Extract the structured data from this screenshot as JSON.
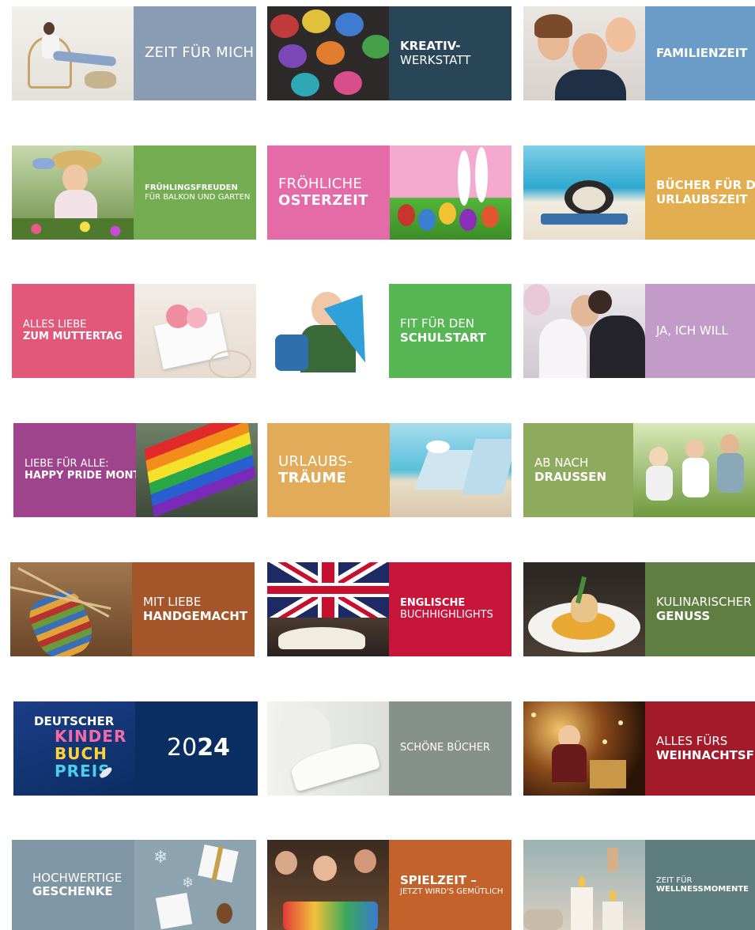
{
  "tiles": [
    {
      "id": "zeit-fuer-mich",
      "color": "#8a9cb4",
      "lines": [
        {
          "text": "ZEIT FÜR MICH",
          "bold": false,
          "size": "lg"
        }
      ]
    },
    {
      "id": "kreativ-werkstatt",
      "color": "#294558",
      "lines": [
        {
          "text": "KREATIV-",
          "bold": true,
          "size": "md"
        },
        {
          "text": "WERKSTATT",
          "bold": false,
          "size": "md"
        }
      ]
    },
    {
      "id": "familienzeit",
      "color": "#6b9cc8",
      "lines": [
        {
          "text": "FAMILIENZEIT",
          "bold": true,
          "size": "md"
        }
      ]
    },
    {
      "id": "fruehlingsfreuden",
      "color": "#74ac52",
      "lines": [
        {
          "text": "FRÜHLINGSFREUDEN",
          "bold": true,
          "size": "xs"
        },
        {
          "text": "FÜR BALKON UND GARTEN",
          "bold": false,
          "size": "xs"
        }
      ]
    },
    {
      "id": "froehliche-osterzeit",
      "color": "#e56aa8",
      "lines": [
        {
          "text": "FRÖHLICHE",
          "bold": false,
          "size": "lg"
        },
        {
          "text": "OSTERZEIT",
          "bold": true,
          "size": "lg"
        }
      ]
    },
    {
      "id": "buecher-urlaubszeit",
      "color": "#e2ae4f",
      "lines": [
        {
          "text": "BÜCHER FÜR DIE",
          "bold": true,
          "size": "md"
        },
        {
          "text": "URLAUBSZEIT",
          "bold": true,
          "size": "md"
        }
      ]
    },
    {
      "id": "muttertag",
      "color": "#e2587b",
      "lines": [
        {
          "text": "ALLES LIEBE",
          "bold": false,
          "size": "sm"
        },
        {
          "text": "ZUM MUTTERTAG",
          "bold": true,
          "size": "sm"
        }
      ]
    },
    {
      "id": "schulstart",
      "color": "#55b653",
      "lines": [
        {
          "text": "FIT FÜR DEN",
          "bold": false,
          "size": "md"
        },
        {
          "text": "SCHULSTART",
          "bold": true,
          "size": "md"
        }
      ]
    },
    {
      "id": "ja-ich-will",
      "color": "#c29bc8",
      "lines": [
        {
          "text": "JA, ICH WILL",
          "bold": false,
          "size": "md"
        }
      ]
    },
    {
      "id": "pride-month",
      "color": "#a0438d",
      "lines": [
        {
          "text": "LIEBE FÜR ALLE:",
          "bold": false,
          "size": "sm"
        },
        {
          "text": "HAPPY PRIDE MONTH",
          "bold": true,
          "size": "sm"
        }
      ]
    },
    {
      "id": "urlaubstraeume",
      "color": "#e1ab59",
      "lines": [
        {
          "text": "URLAUBS-",
          "bold": false,
          "size": "lg"
        },
        {
          "text": "TRÄUME",
          "bold": true,
          "size": "lg"
        }
      ]
    },
    {
      "id": "ab-nach-draussen",
      "color": "#8daa5d",
      "lines": [
        {
          "text": "AB NACH",
          "bold": false,
          "size": "md"
        },
        {
          "text": "DRAUSSEN",
          "bold": true,
          "size": "md"
        }
      ]
    },
    {
      "id": "handgemacht",
      "color": "#a4552a",
      "lines": [
        {
          "text": "MIT LIEBE",
          "bold": false,
          "size": "md"
        },
        {
          "text": "HANDGEMACHT",
          "bold": true,
          "size": "md"
        }
      ]
    },
    {
      "id": "englische-buchhighlights",
      "color": "#c8163a",
      "lines": [
        {
          "text": "ENGLISCHE",
          "bold": true,
          "size": "sm"
        },
        {
          "text": "BUCHHIGHLIGHTS",
          "bold": false,
          "size": "sm"
        }
      ]
    },
    {
      "id": "kulinarischer-genuss",
      "color": "#5f7e42",
      "lines": [
        {
          "text": "KULINARISCHER",
          "bold": false,
          "size": "md"
        },
        {
          "text": "GENUSS",
          "bold": true,
          "size": "md"
        }
      ]
    },
    {
      "id": "kinderbuchpreis",
      "color": "#0a2e62",
      "year_a": "20",
      "year_b": "24",
      "logo": [
        "DEUTSCHER",
        "KINDER",
        "BUCH",
        "PREIS"
      ],
      "lines": []
    },
    {
      "id": "schoene-buecher",
      "color": "#86918c",
      "lines": [
        {
          "text": "SCHÖNE BÜCHER",
          "bold": false,
          "size": "sm"
        }
      ]
    },
    {
      "id": "weihnachtsfest",
      "color": "#a31b2a",
      "lines": [
        {
          "text": "ALLES FÜRS",
          "bold": false,
          "size": "md"
        },
        {
          "text": "WEIHNACHTSFEST",
          "bold": true,
          "size": "md"
        }
      ]
    },
    {
      "id": "hochwertige-geschenke",
      "color": "#7f97a5",
      "lines": [
        {
          "text": "HOCHWERTIGE",
          "bold": false,
          "size": "md"
        },
        {
          "text": "GESCHENKE",
          "bold": true,
          "size": "md"
        }
      ]
    },
    {
      "id": "spielzeit",
      "color": "#c4622c",
      "lines": [
        {
          "text": "SPIELZEIT –",
          "bold": true,
          "size": "md"
        },
        {
          "text": "JETZT WIRD'S GEMÜTLICH",
          "bold": false,
          "size": "xs"
        }
      ]
    },
    {
      "id": "wellnessmomente",
      "color": "#5e7d7f",
      "lines": [
        {
          "text": "ZEIT FÜR",
          "bold": false,
          "size": "xs"
        },
        {
          "text": "WELLNESSMOMENTE",
          "bold": true,
          "size": "xs"
        }
      ]
    }
  ]
}
